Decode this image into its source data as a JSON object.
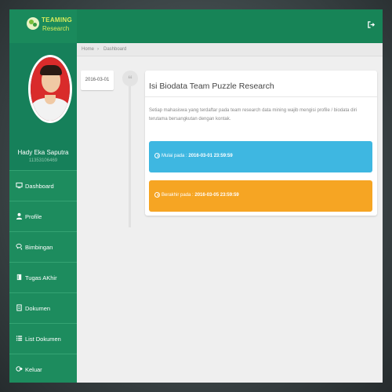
{
  "header": {
    "logo_line1": "TEAMING",
    "logo_line2": "Research",
    "logout_icon": "sign-out-icon"
  },
  "profile": {
    "name": "Hady Eka Saputra",
    "id": "11353106469"
  },
  "sidebar": {
    "items": [
      {
        "label": "Dashboard",
        "icon": "desktop-icon"
      },
      {
        "label": "Profile",
        "icon": "user-icon"
      },
      {
        "label": "Bimbingan",
        "icon": "comments-icon"
      },
      {
        "label": "Tugas AKhir",
        "icon": "book-icon"
      },
      {
        "label": "Dokumen",
        "icon": "document-icon"
      },
      {
        "label": "List Dokumen",
        "icon": "list-icon"
      },
      {
        "label": "Keluar",
        "icon": "sign-out-icon"
      }
    ]
  },
  "breadcrumb": {
    "home": "Home",
    "separator": "›",
    "current": "Dashboard"
  },
  "timeline": {
    "date": "2016-03-01",
    "quote_icon": "quote-icon"
  },
  "card": {
    "title": "Isi Biodata Team Puzzle Research",
    "description": "Setiap mahasiswa yang terdaftar pada team research data mining wajib mengisi profile / biodata diri terutama bersangkutan dengan kontak.",
    "start_label": "Mulai pada :",
    "start_value": "2016-03-01 23:59:59",
    "end_label": "Berakhir pada :",
    "end_value": "2016-03-05 23:59:59"
  },
  "colors": {
    "brand_green": "#178457",
    "sidebar_green": "#1d8c5e",
    "info_blue": "#3eb7e1",
    "warning_orange": "#f6a523"
  }
}
